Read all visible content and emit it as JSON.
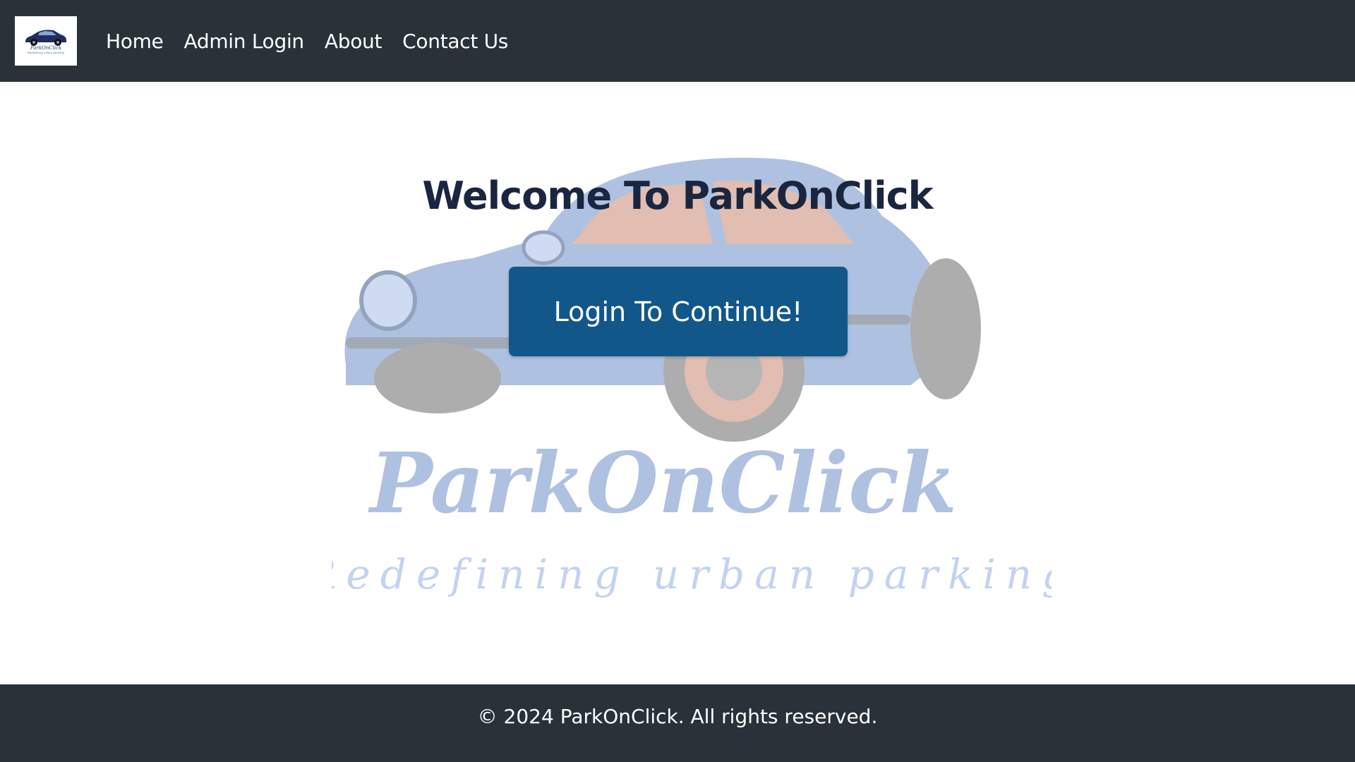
{
  "navbar": {
    "logo": {
      "brand": "ParkOnClick",
      "tagline": "Redefining urban parking"
    },
    "links": [
      {
        "label": "Home"
      },
      {
        "label": "Admin Login"
      },
      {
        "label": "About"
      },
      {
        "label": "Contact Us"
      }
    ]
  },
  "hero": {
    "title": "Welcome To ParkOnClick",
    "button_label": "Login To Continue!",
    "background": {
      "brand": "ParkOnClick",
      "tagline": "Redefining urban parking"
    }
  },
  "footer": {
    "text": "© 2024 ParkOnClick. All rights reserved."
  },
  "colors": {
    "navbar": "#283238",
    "button": "#12578a",
    "title": "#1a2540",
    "car": "#6f8fc9"
  }
}
